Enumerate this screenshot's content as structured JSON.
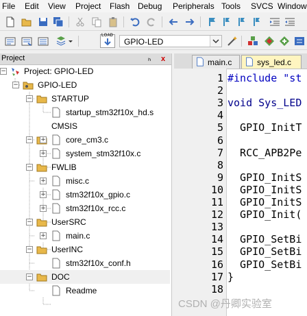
{
  "menu": [
    "File",
    "Edit",
    "View",
    "Project",
    "Flash",
    "Debug",
    "Peripherals",
    "Tools",
    "SVCS",
    "Window"
  ],
  "target": {
    "name": "GPIO-LED",
    "load_label": "LOAD"
  },
  "project_panel": {
    "title": "Project",
    "pin": "ₕ",
    "close": "x",
    "tree": [
      {
        "label": "Project: GPIO-LED",
        "type": "project"
      },
      {
        "label": "GPIO-LED",
        "type": "target"
      },
      {
        "label": "STARTUP",
        "type": "group"
      },
      {
        "label": "startup_stm32f10x_hd.s",
        "type": "file"
      },
      {
        "label": "CMSIS",
        "type": "group"
      },
      {
        "label": "core_cm3.c",
        "type": "file"
      },
      {
        "label": "system_stm32f10x.c",
        "type": "file"
      },
      {
        "label": "FWLIB",
        "type": "group"
      },
      {
        "label": "misc.c",
        "type": "file"
      },
      {
        "label": "stm32f10x_gpio.c",
        "type": "file"
      },
      {
        "label": "stm32f10x_rcc.c",
        "type": "file"
      },
      {
        "label": "UserSRC",
        "type": "group"
      },
      {
        "label": "main.c",
        "type": "file"
      },
      {
        "label": "UserINC",
        "type": "group"
      },
      {
        "label": "stm32f10x_conf.h",
        "type": "file"
      },
      {
        "label": "DOC",
        "type": "group"
      },
      {
        "label": "Readme",
        "type": "file"
      }
    ]
  },
  "editor": {
    "tabs": [
      {
        "label": "main.c",
        "active": false
      },
      {
        "label": "sys_led.c",
        "active": true
      }
    ],
    "line_numbers": [
      "1",
      "2",
      "3",
      "4",
      "5",
      "6",
      "7",
      "8",
      "9",
      "10",
      "11",
      "12",
      "13",
      "14",
      "15",
      "16",
      "17",
      "18"
    ],
    "lines": [
      "#include \"st",
      "",
      "void Sys_LED",
      "",
      "  GPIO_InitT",
      "",
      "  RCC_APB2Pe",
      "",
      "  GPIO_InitS",
      "  GPIO_InitS",
      "  GPIO_InitS",
      "  GPIO_Init(",
      "",
      "  GPIO_SetBi",
      "  GPIO_SetBi",
      "  GPIO_SetBi",
      "}",
      ""
    ]
  },
  "watermark": "CSDN @丹卿实验室",
  "colors": {
    "active_tab": "#fff5c0",
    "folder": "#e8b84a",
    "keyword": "#00008b"
  }
}
